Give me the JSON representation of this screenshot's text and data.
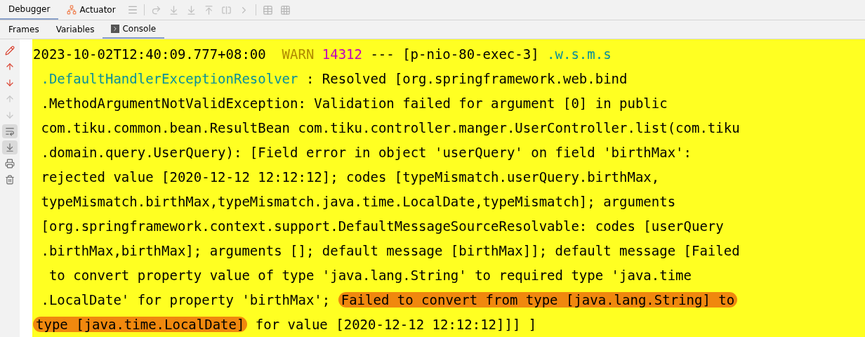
{
  "top_tabs": [
    {
      "label": "Debugger",
      "selected": true
    },
    {
      "label": "Actuator",
      "selected": false
    }
  ],
  "sub_tabs": [
    {
      "label": "Frames",
      "selected": false
    },
    {
      "label": "Variables",
      "selected": false
    },
    {
      "label": "Console",
      "selected": true
    }
  ],
  "gutter": [
    {
      "kind": "clear",
      "on": false,
      "disabled": false
    },
    {
      "kind": "up",
      "on": false,
      "disabled": false
    },
    {
      "kind": "down",
      "on": false,
      "disabled": false
    },
    {
      "kind": "up",
      "on": false,
      "disabled": true
    },
    {
      "kind": "down",
      "on": false,
      "disabled": true
    },
    {
      "kind": "wrap",
      "on": true,
      "disabled": false
    },
    {
      "kind": "scroll",
      "on": true,
      "disabled": false
    },
    {
      "kind": "print",
      "on": false,
      "disabled": false
    },
    {
      "kind": "trash",
      "on": false,
      "disabled": false
    }
  ],
  "console": {
    "lines": [
      [
        {
          "kind": "plain",
          "text": "2023-10-02T12:40:09.777+08:00  "
        },
        {
          "kind": "warn",
          "text": "WARN"
        },
        {
          "kind": "pid",
          "text": "14312"
        },
        {
          "kind": "plain",
          "text": " --- [p-nio-80-exec-3] "
        },
        {
          "kind": "logger",
          "text": ".w.s.m.s"
        }
      ],
      [
        {
          "kind": "logger",
          "text": " .DefaultHandlerExceptionResolver"
        },
        {
          "kind": "plain",
          "text": " : Resolved [org.springframework.web.bind"
        }
      ],
      [
        {
          "kind": "plain",
          "text": " .MethodArgumentNotValidException: Validation failed for argument [0] in public"
        }
      ],
      [
        {
          "kind": "plain",
          "text": " com.tiku.common.bean.ResultBean com.tiku.controller.manger.UserController.list(com.tiku"
        }
      ],
      [
        {
          "kind": "plain",
          "text": " .domain.query.UserQuery): [Field error in object 'userQuery' on field 'birthMax':"
        }
      ],
      [
        {
          "kind": "plain",
          "text": " rejected value [2020-12-12 12:12:12]; codes [typeMismatch.userQuery.birthMax,"
        }
      ],
      [
        {
          "kind": "plain",
          "text": " typeMismatch.birthMax,typeMismatch.java.time.LocalDate,typeMismatch]; arguments"
        }
      ],
      [
        {
          "kind": "plain",
          "text": " [org.springframework.context.support.DefaultMessageSourceResolvable: codes [userQuery"
        }
      ],
      [
        {
          "kind": "plain",
          "text": " .birthMax,birthMax]; arguments []; default message [birthMax]]; default message [Failed"
        }
      ],
      [
        {
          "kind": "plain",
          "text": "  to convert property value of type 'java.lang.String' to required type 'java.time"
        }
      ],
      [
        {
          "kind": "plain",
          "text": " .LocalDate' for property 'birthMax'; "
        },
        {
          "kind": "highlight",
          "text": "Failed to convert from type [java.lang.String] to"
        }
      ],
      [
        {
          "kind": "highlight",
          "text": "type [java.time.LocalDate]"
        },
        {
          "kind": "plain",
          "text": " for value [2020-12-12 12:12:12]]] ]"
        }
      ]
    ]
  }
}
